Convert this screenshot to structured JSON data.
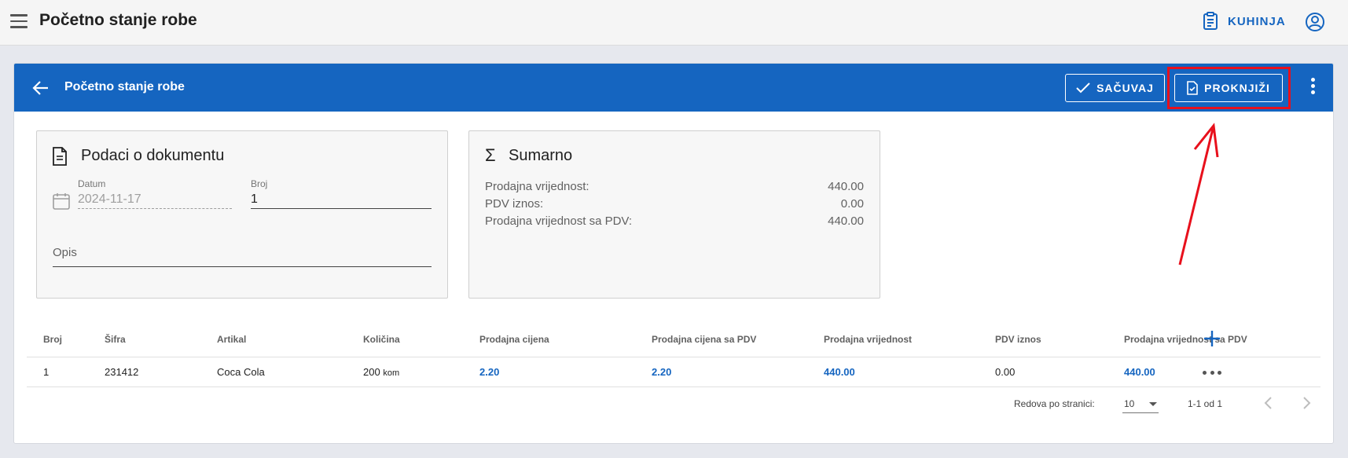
{
  "app": {
    "title": "Početno stanje robe",
    "kitchen_label": "KUHINJA"
  },
  "header": {
    "title": "Početno stanje robe",
    "save_label": "SAČUVAJ",
    "post_label": "PROKNJIŽI"
  },
  "document_panel": {
    "title": "Podaci o dokumentu",
    "date_label": "Datum",
    "date_value": "2024-11-17",
    "number_label": "Broj",
    "number_value": "1",
    "description_placeholder": "Opis"
  },
  "summary_panel": {
    "title": "Sumarno",
    "rows": [
      {
        "label": "Prodajna vrijednost:",
        "value": "440.00"
      },
      {
        "label": "PDV iznos:",
        "value": "0.00"
      },
      {
        "label": "Prodajna vrijednost sa PDV:",
        "value": "440.00"
      }
    ]
  },
  "table": {
    "columns": [
      "Broj",
      "Šifra",
      "Artikal",
      "Količina",
      "Prodajna cijena",
      "Prodajna cijena sa PDV",
      "Prodajna vrijednost",
      "PDV iznos",
      "Prodajna vrijednost sa PDV"
    ],
    "rows": [
      {
        "broj": "1",
        "sifra": "231412",
        "artikal": "Coca Cola",
        "kolicina": "200",
        "jedinica": "kom",
        "prodajna_cijena": "2.20",
        "prodajna_cijena_pdv": "2.20",
        "prodajna_vrijednost": "440.00",
        "pdv_iznos": "0.00",
        "prodajna_vrijednost_pdv": "440.00"
      }
    ]
  },
  "pagination": {
    "rows_per_page_label": "Redova po stranici:",
    "rows_per_page": "10",
    "range": "1-1 od 1"
  },
  "colors": {
    "primary": "#1565c0",
    "highlight": "#e8101c"
  },
  "icons": [
    "menu-icon",
    "clipboard-list-icon",
    "account-circle-icon",
    "arrow-back-icon",
    "check-icon",
    "file-check-icon",
    "more-vert-icon",
    "document-icon",
    "calendar-icon",
    "sigma-icon",
    "plus-icon",
    "more-horiz-icon",
    "chevron-left-icon",
    "chevron-right-icon"
  ]
}
